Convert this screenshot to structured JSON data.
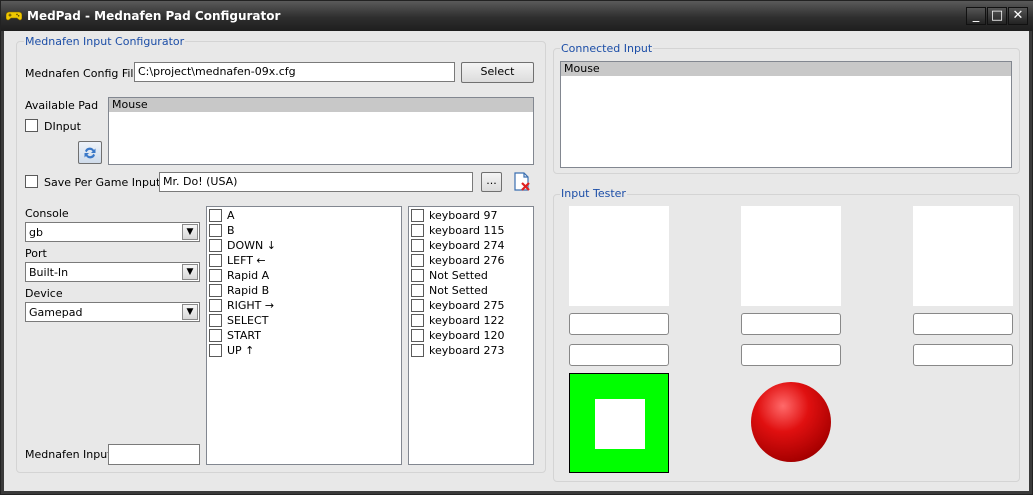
{
  "window": {
    "title": "MedPad - Mednafen Pad Configurator",
    "minimize": "_",
    "maximize": "□",
    "close": "✕"
  },
  "config_group": {
    "title": "Mednafen Input Configurator",
    "config_file_label": "Mednafen Config File",
    "config_file_value": "C:\\project\\mednafen-09x.cfg",
    "select_button": "Select",
    "available_pad_label": "Available Pad",
    "dinput_label": "DInput",
    "available_pads": [
      "Mouse"
    ],
    "save_per_game_label": "Save Per Game Input",
    "game_value": "Mr. Do! (USA)",
    "browse_button": "...",
    "console_label": "Console",
    "console_value": "gb",
    "port_label": "Port",
    "port_value": "Built-In",
    "device_label": "Device",
    "device_value": "Gamepad",
    "mednafen_input_label": "Mednafen Input",
    "mednafen_input_value": ""
  },
  "buttons_list": [
    "A",
    "B",
    "DOWN ↓",
    "LEFT ←",
    "Rapid A",
    "Rapid B",
    "RIGHT →",
    "SELECT",
    "START",
    "UP ↑"
  ],
  "bindings_list": [
    "keyboard 97",
    "keyboard 115",
    "keyboard 274",
    "keyboard 276",
    "Not Setted",
    "Not Setted",
    "keyboard 275",
    "keyboard 122",
    "keyboard 120",
    "keyboard 273"
  ],
  "connected_group": {
    "title": "Connected Input",
    "items": [
      "Mouse"
    ]
  },
  "tester_group": {
    "title": "Input Tester"
  },
  "colors": {
    "accent_text": "#1c4ea7",
    "tester_green": "#00ff00",
    "tester_red": "#d00000"
  }
}
